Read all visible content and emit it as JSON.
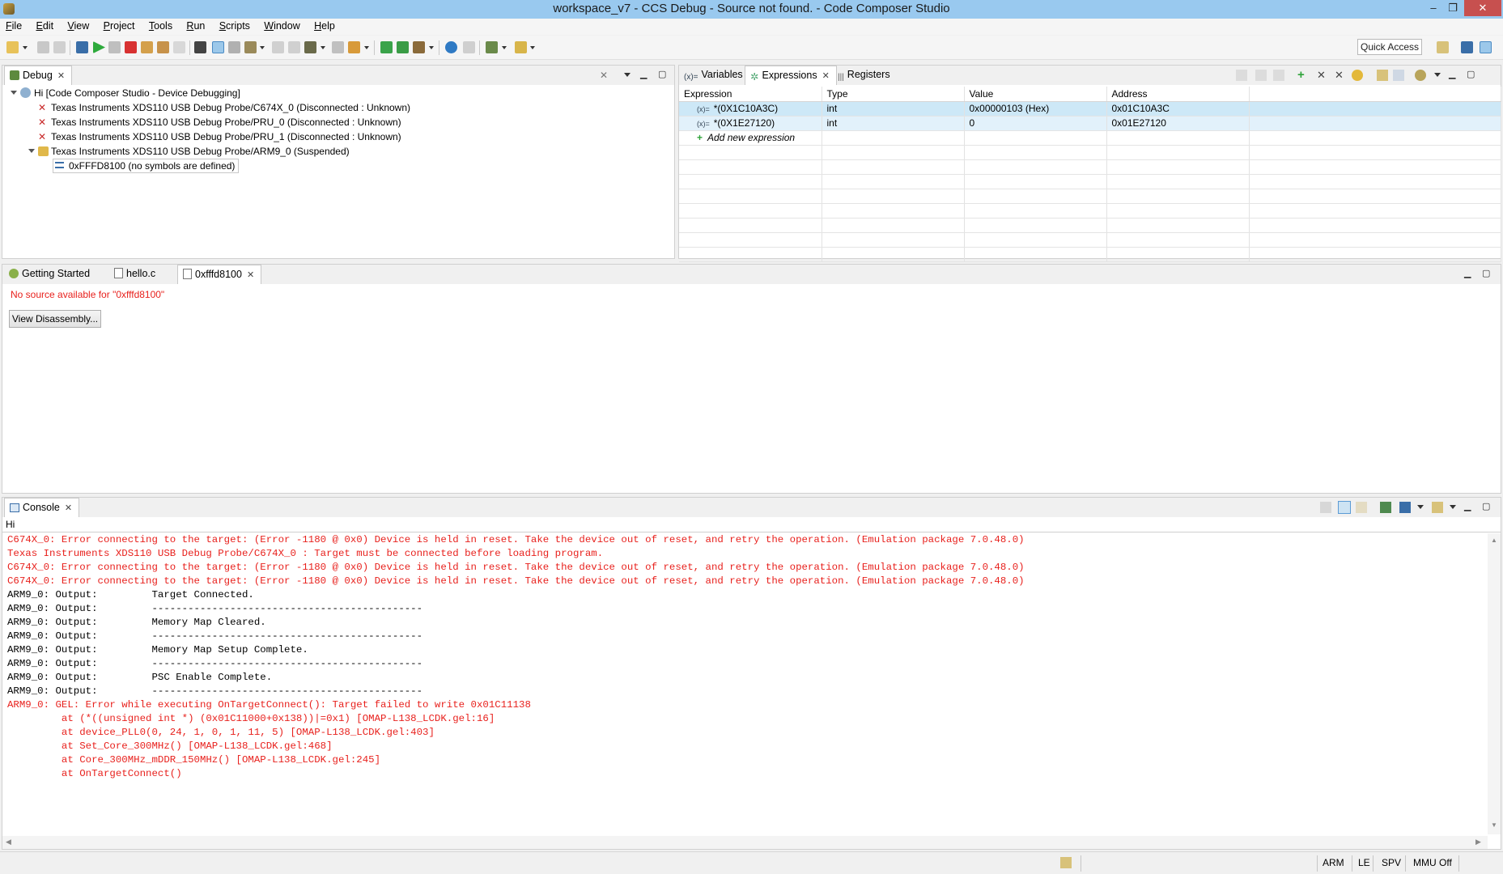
{
  "window": {
    "title": "workspace_v7 - CCS Debug - Source not found. - Code Composer Studio",
    "minimize": "–",
    "restore": "❐",
    "close": "✕"
  },
  "menu": [
    "File",
    "Edit",
    "View",
    "Project",
    "Tools",
    "Run",
    "Scripts",
    "Window",
    "Help"
  ],
  "toolbar": {
    "quick_access": "Quick Access"
  },
  "debug_view": {
    "tab_label": "Debug",
    "root": "Hi [Code Composer Studio - Device Debugging]",
    "items": [
      "Texas Instruments XDS110 USB Debug Probe/C674X_0 (Disconnected : Unknown)",
      "Texas Instruments XDS110 USB Debug Probe/PRU_0 (Disconnected : Unknown)",
      "Texas Instruments XDS110 USB Debug Probe/PRU_1 (Disconnected : Unknown)",
      "Texas Instruments XDS110 USB Debug Probe/ARM9_0 (Suspended)"
    ],
    "frame": "0xFFFD8100  (no symbols are defined)"
  },
  "expressions_view": {
    "tabs": [
      "Variables",
      "Expressions",
      "Registers"
    ],
    "columns": [
      "Expression",
      "Type",
      "Value",
      "Address"
    ],
    "rows": [
      {
        "expression": "*(0X1C10A3C)",
        "type": "int",
        "value": "0x00000103 (Hex)",
        "address": "0x01C10A3C"
      },
      {
        "expression": "*(0X1E27120)",
        "type": "int",
        "value": "0",
        "address": "0x01E27120"
      }
    ],
    "add_label": "Add new expression"
  },
  "editor": {
    "tabs": [
      "Getting Started",
      "hello.c",
      "0xfffd8100"
    ],
    "message": "No source available for \"0xfffd8100\"",
    "button": "View Disassembly..."
  },
  "console": {
    "tab_label": "Console",
    "name": "Hi",
    "lines": [
      {
        "kind": "err",
        "text": "C674X_0: Error connecting to the target: (Error -1180 @ 0x0) Device is held in reset. Take the device out of reset, and retry the operation. (Emulation package 7.0.48.0)"
      },
      {
        "kind": "err",
        "text": "Texas Instruments XDS110 USB Debug Probe/C674X_0 : Target must be connected before loading program."
      },
      {
        "kind": "err",
        "text": "C674X_0: Error connecting to the target: (Error -1180 @ 0x0) Device is held in reset. Take the device out of reset, and retry the operation. (Emulation package 7.0.48.0)"
      },
      {
        "kind": "err",
        "text": "C674X_0: Error connecting to the target: (Error -1180 @ 0x0) Device is held in reset. Take the device out of reset, and retry the operation. (Emulation package 7.0.48.0)"
      },
      {
        "kind": "out",
        "text": "ARM9_0: Output:         Target Connected."
      },
      {
        "kind": "out",
        "text": "ARM9_0: Output:         ---------------------------------------------"
      },
      {
        "kind": "out",
        "text": "ARM9_0: Output:         Memory Map Cleared."
      },
      {
        "kind": "out",
        "text": "ARM9_0: Output:         ---------------------------------------------"
      },
      {
        "kind": "out",
        "text": "ARM9_0: Output:         Memory Map Setup Complete."
      },
      {
        "kind": "out",
        "text": "ARM9_0: Output:         ---------------------------------------------"
      },
      {
        "kind": "out",
        "text": "ARM9_0: Output:         PSC Enable Complete."
      },
      {
        "kind": "out",
        "text": "ARM9_0: Output:         ---------------------------------------------"
      },
      {
        "kind": "err",
        "text": "ARM9_0: GEL: Error while executing OnTargetConnect(): Target failed to write 0x01C11138"
      },
      {
        "kind": "err",
        "text": "         at (*((unsigned int *) (0x01C11000+0x138))|=0x1) [OMAP-L138_LCDK.gel:16]"
      },
      {
        "kind": "err",
        "text": "         at device_PLL0(0, 24, 1, 0, 1, 11, 5) [OMAP-L138_LCDK.gel:403]"
      },
      {
        "kind": "err",
        "text": "         at Set_Core_300MHz() [OMAP-L138_LCDK.gel:468]"
      },
      {
        "kind": "err",
        "text": "         at Core_300MHz_mDDR_150MHz() [OMAP-L138_LCDK.gel:245]"
      },
      {
        "kind": "err",
        "text": "         at OnTargetConnect()"
      }
    ]
  },
  "status": {
    "arm": "ARM",
    "le": "LE",
    "spv": "SPV",
    "mmu": "MMU Off"
  },
  "colors": {
    "titlebar": "#99c9ef",
    "error_text": "#e8211d",
    "selection": "#cde8f7"
  }
}
